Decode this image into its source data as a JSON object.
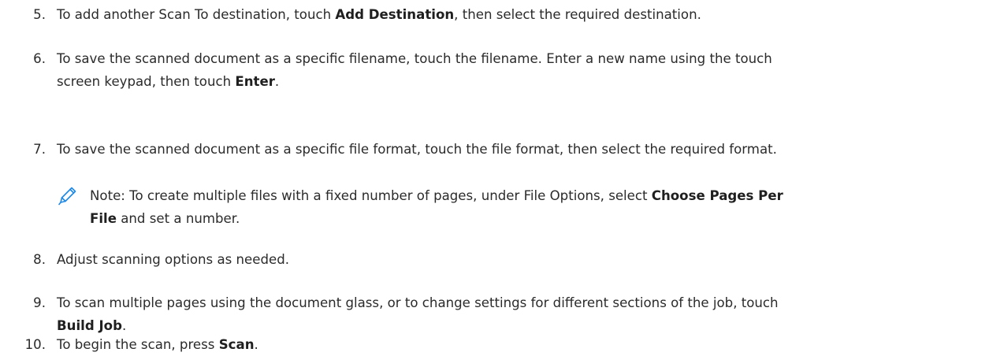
{
  "steps": [
    {
      "num": "5.",
      "p1": "To add another Scan To destination, touch ",
      "b1": "Add Destination",
      "p2": ", then select the required destination."
    },
    {
      "num": "6.",
      "line1": "To save the scanned document as a specific filename, touch the filename. Enter a new name using the touch",
      "p1": "screen keypad, then touch ",
      "b1": "Enter",
      "p2": "."
    },
    {
      "num": "7.",
      "text": "To save the scanned document as a specific file format, touch the file format, then select the required format."
    },
    {
      "num": "8.",
      "text": "Adjust scanning options as needed."
    },
    {
      "num": "9.",
      "line1": "To scan multiple pages using the document glass, or to change settings for different sections of the job, touch",
      "b1": "Build Job",
      "p2": "."
    },
    {
      "num": "10.",
      "p1": "To begin the scan, press ",
      "b1": "Scan",
      "p2": "."
    }
  ],
  "note": {
    "icon": "pencil-icon",
    "icon_color": "#1e88e5",
    "p1": "Note: To create multiple files with a fixed number of pages, under File Options, select ",
    "b1": "Choose Pages Per",
    "b2": "File",
    "p2": " and set a number."
  }
}
